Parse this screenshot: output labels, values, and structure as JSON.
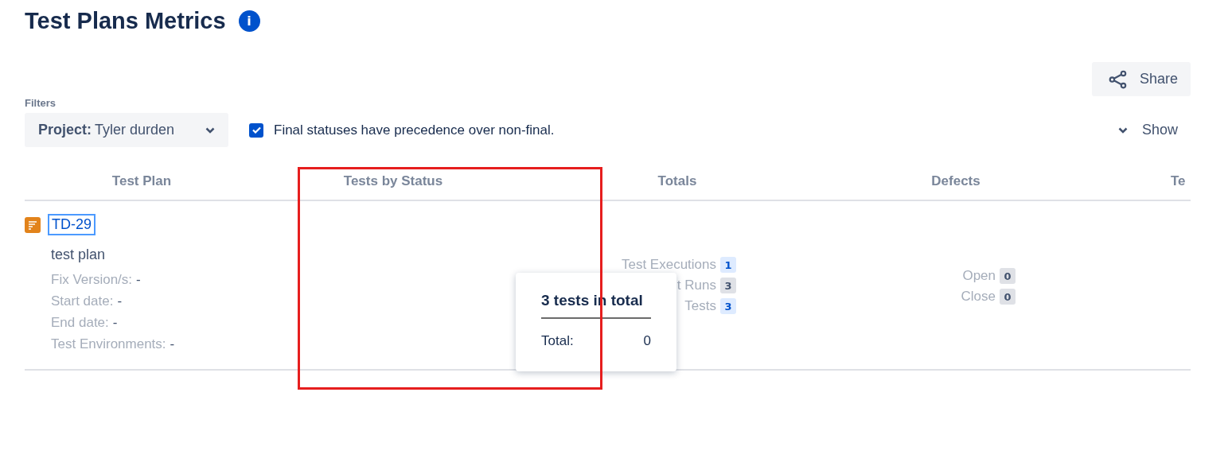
{
  "page": {
    "title": "Test Plans Metrics",
    "info_icon": "i"
  },
  "share_button": {
    "label": "Share"
  },
  "filters": {
    "label": "Filters",
    "project": {
      "label": "Project:",
      "value": "Tyler durden"
    },
    "final_precedence": {
      "label": "Final statuses have precedence over non-final.",
      "checked": true
    },
    "show_toggle": {
      "label": "Show",
      "expanded": false
    }
  },
  "table": {
    "columns": [
      "Test Plan",
      "Tests by Status",
      "Totals",
      "Defects",
      "Te"
    ],
    "rows": [
      {
        "key": "TD-29",
        "summary": "test plan",
        "fields": [
          {
            "label": "Fix Version/s:",
            "value": "-"
          },
          {
            "label": "Start date:",
            "value": "-"
          },
          {
            "label": "End date:",
            "value": "-"
          },
          {
            "label": "Test Environments:",
            "value": "-"
          }
        ],
        "totals": [
          {
            "label": "Test Executions",
            "count": "1",
            "kind": "blue"
          },
          {
            "label": "t Runs",
            "count": "3",
            "kind": "grey"
          },
          {
            "label": "Tests",
            "count": "3",
            "kind": "blue"
          }
        ],
        "defects": [
          {
            "label": "Open",
            "count": "0"
          },
          {
            "label": "Close",
            "count": "0"
          }
        ]
      }
    ]
  },
  "tooltip": {
    "title": "3 tests in total",
    "label": "Total:",
    "value": "0"
  },
  "annotation": {
    "kind": "highlight-box"
  }
}
